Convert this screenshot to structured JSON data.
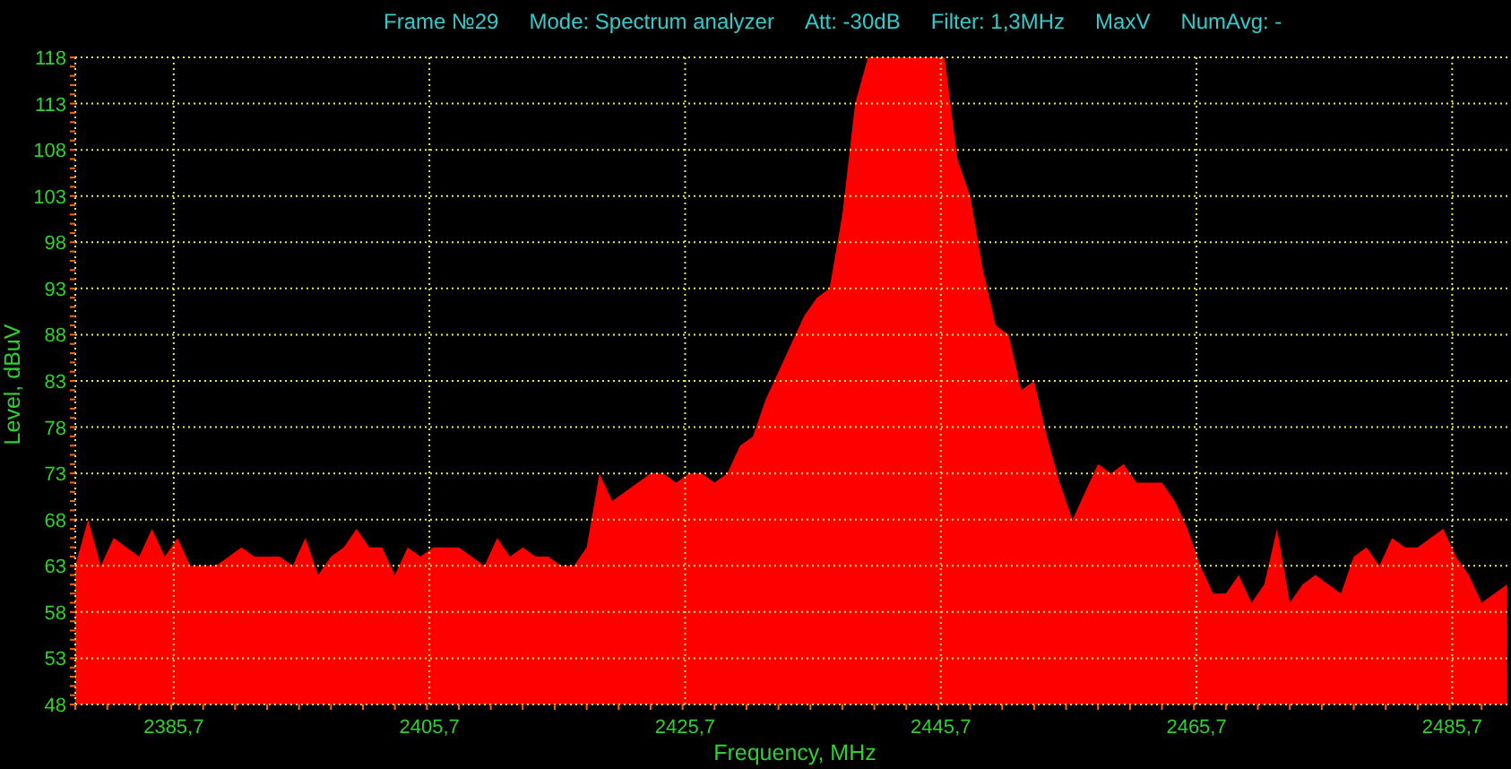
{
  "header": {
    "items": [
      "Frame №29",
      "Mode: Spectrum analyzer",
      "Att: -30dB",
      "Filter: 1,3MHz",
      "MaxV",
      "NumAvg: -"
    ]
  },
  "spectrum": {
    "chart_data": {
      "type": "area",
      "xlabel": "Frequency, MHz",
      "ylabel": "Level, dBuV",
      "xlim": [
        2378,
        2490.3
      ],
      "ylim": [
        48,
        118
      ],
      "grid": true,
      "xticks": [
        {
          "value": 2385.7,
          "label": "2385,7"
        },
        {
          "value": 2405.7,
          "label": "2405,7"
        },
        {
          "value": 2425.7,
          "label": "2425,7"
        },
        {
          "value": 2445.7,
          "label": "2445,7"
        },
        {
          "value": 2465.7,
          "label": "2465,7"
        },
        {
          "value": 2485.7,
          "label": "2485,7"
        }
      ],
      "yticks": [
        48,
        53,
        58,
        63,
        68,
        73,
        78,
        83,
        88,
        93,
        98,
        103,
        108,
        113,
        118
      ],
      "x": [
        2378,
        2379,
        2380,
        2381,
        2382,
        2383,
        2384,
        2385,
        2386,
        2387,
        2388,
        2389,
        2390,
        2391,
        2392,
        2393,
        2394,
        2395,
        2396,
        2397,
        2398,
        2399,
        2400,
        2401,
        2402,
        2403,
        2404,
        2405,
        2406,
        2407,
        2408,
        2409,
        2410,
        2411,
        2412,
        2413,
        2414,
        2415,
        2416,
        2417,
        2418,
        2419,
        2420,
        2421,
        2422,
        2423,
        2424,
        2425,
        2426,
        2427,
        2428,
        2429,
        2430,
        2431,
        2432,
        2433,
        2434,
        2435,
        2436,
        2437,
        2438,
        2439,
        2440,
        2441,
        2442,
        2443,
        2444,
        2445,
        2446,
        2447,
        2448,
        2449,
        2450,
        2451,
        2452,
        2453,
        2454,
        2455,
        2456,
        2457,
        2458,
        2459,
        2460,
        2461,
        2462,
        2463,
        2464,
        2465,
        2466,
        2467,
        2468,
        2469,
        2470,
        2471,
        2472,
        2473,
        2474,
        2475,
        2476,
        2477,
        2478,
        2479,
        2480,
        2481,
        2482,
        2483,
        2484,
        2485,
        2486,
        2487,
        2488,
        2489,
        2490
      ],
      "series": [
        {
          "color": "#ff0000",
          "values": [
            63,
            68,
            63,
            66,
            65,
            64,
            67,
            64,
            66,
            63,
            63,
            63,
            64,
            65,
            64,
            64,
            64,
            63,
            66,
            62,
            64,
            65,
            67,
            65,
            65,
            62,
            65,
            64,
            65,
            65,
            65,
            64,
            63,
            66,
            64,
            65,
            64,
            64,
            63,
            63,
            65,
            73,
            70,
            71,
            72,
            73,
            73,
            72,
            73,
            73,
            72,
            73,
            76,
            77,
            81,
            84,
            87,
            90,
            92,
            93,
            101,
            113,
            118,
            118,
            118,
            118,
            118,
            118,
            118,
            107,
            103,
            95,
            89,
            88,
            82,
            83,
            77,
            72,
            68,
            71,
            74,
            73,
            74,
            72,
            72,
            72,
            70,
            67,
            63,
            60,
            60,
            62,
            59,
            61,
            67,
            59,
            61,
            62,
            61,
            60,
            64,
            65,
            63,
            66,
            65,
            65,
            66,
            67,
            64,
            62,
            59,
            60,
            61
          ]
        }
      ]
    }
  }
}
